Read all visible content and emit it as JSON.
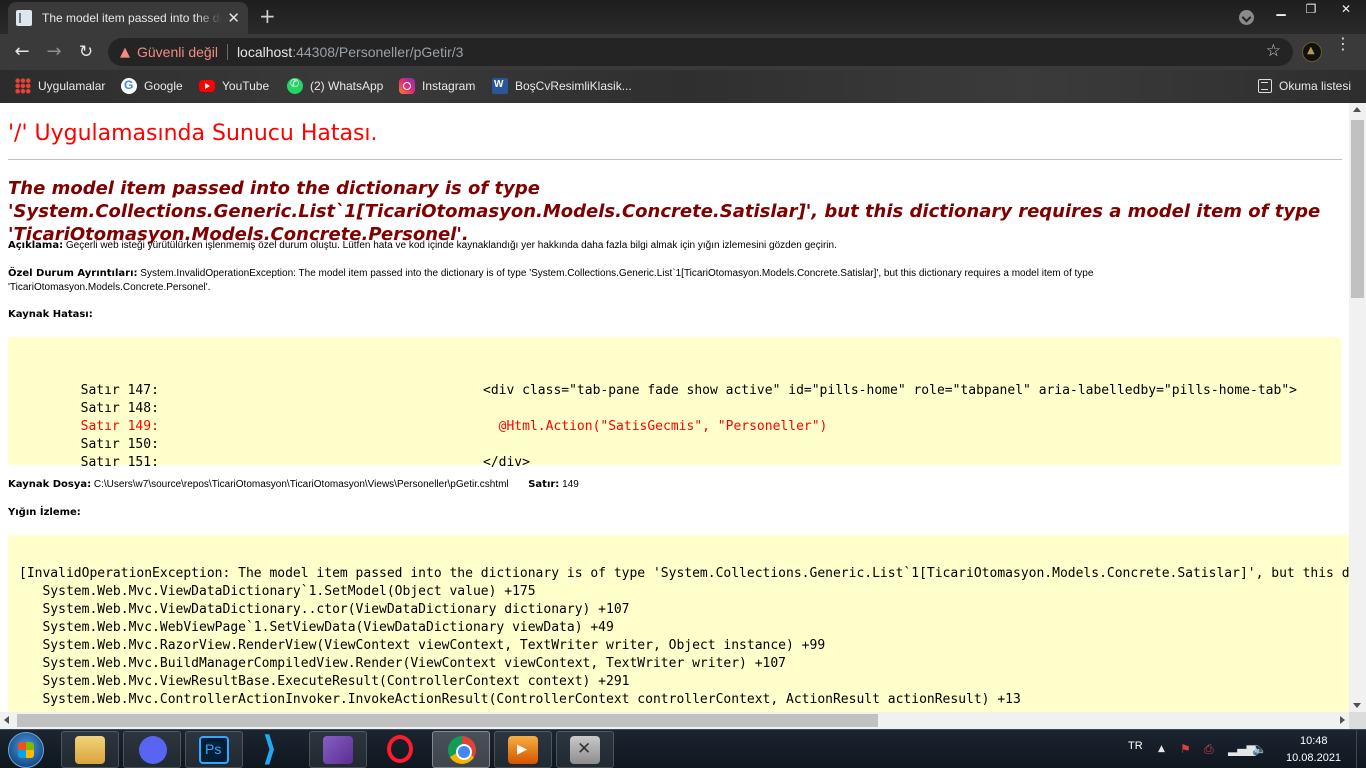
{
  "browser": {
    "tab_title": "The model item passed into the dictionary is of type",
    "tab_close": "✕",
    "new_tab": "+",
    "window_controls": {
      "minimize": "▁",
      "maximize": "❐",
      "close": "✕"
    },
    "nav": {
      "back": "←",
      "forward": "→",
      "reload": "↻"
    },
    "security_label": "Güvenli değil",
    "warning_glyph": "▲",
    "url_host": "localhost",
    "url_path": ":44308/Personeller/pGetir/3",
    "star_glyph": "☆",
    "menu_glyph": "⋮"
  },
  "bookmarks": [
    {
      "label": "Uygulamalar",
      "icon": "apps-grid-icon"
    },
    {
      "label": "Google",
      "icon": "google-icon"
    },
    {
      "label": "YouTube",
      "icon": "youtube-icon"
    },
    {
      "label": "(2) WhatsApp",
      "icon": "whatsapp-icon"
    },
    {
      "label": "Instagram",
      "icon": "instagram-icon"
    },
    {
      "label": "BoşCvResimliKlasik...",
      "icon": "word-icon"
    }
  ],
  "reading_list": "Okuma listesi",
  "page": {
    "title": "'/' Uygulamasında Sunucu Hatası.",
    "message": "The model item passed into the dictionary is of type 'System.Collections.Generic.List`1[TicariOtomasyon.Models.Concrete.Satislar]', but this dictionary requires a model item of type 'TicariOtomasyon.Models.Concrete.Personel'.",
    "description_label": "Açıklama:",
    "description_text": "Geçerli web isteği yürütülürken işlenmemiş özel durum oluştu. Lütfen hata ve kod içinde kaynaklandığı yer hakkında daha fazla bilgi almak için yığın izlemesini gözden geçirin.",
    "details_label": "Özel Durum Ayrıntıları:",
    "details_text": "System.InvalidOperationException: The model item passed into the dictionary is of type 'System.Collections.Generic.List`1[TicariOtomasyon.Models.Concrete.Satislar]', but this dictionary requires a model item of type 'TicariOtomasyon.Models.Concrete.Personel'.",
    "source_error_heading": "Kaynak Hatası:",
    "source_lines": [
      {
        "label": "Satır 147:",
        "code": "<div class=\"tab-pane fade show active\" id=\"pills-home\" role=\"tabpanel\" aria-labelledby=\"pills-home-tab\">"
      },
      {
        "label": "Satır 148:",
        "code": ""
      },
      {
        "label": "Satır 149:",
        "code": "  @Html.Action(\"SatisGecmis\", \"Personeller\")"
      },
      {
        "label": "Satır 150:",
        "code": ""
      },
      {
        "label": "Satır 151:",
        "code": "</div>"
      }
    ],
    "source_file_label": "Kaynak Dosya:",
    "source_file_path": "C:\\Users\\w7\\source\\repos\\TicariOtomasyon\\TicariOtomasyon\\Views\\Personeller\\pGetir.cshtml",
    "line_label": "Satır:",
    "line_value": "149",
    "stack_heading": "Yığın İzleme:",
    "stack_lines": [
      "[InvalidOperationException: The model item passed into the dictionary is of type 'System.Collections.Generic.List`1[TicariOtomasyon.Models.Concrete.Satislar]', but this dictionary requires a model item of type 'TicariOtomasyon.Models.Concrete.Personel'.]",
      "   System.Web.Mvc.ViewDataDictionary`1.SetModel(Object value) +175",
      "   System.Web.Mvc.ViewDataDictionary..ctor(ViewDataDictionary dictionary) +107",
      "   System.Web.Mvc.WebViewPage`1.SetViewData(ViewDataDictionary viewData) +49",
      "   System.Web.Mvc.RazorView.RenderView(ViewContext viewContext, TextWriter writer, Object instance) +99",
      "   System.Web.Mvc.BuildManagerCompiledView.Render(ViewContext viewContext, TextWriter writer) +107",
      "   System.Web.Mvc.ViewResultBase.ExecuteResult(ControllerContext context) +291",
      "   System.Web.Mvc.ControllerActionInvoker.InvokeActionResult(ControllerContext controllerContext, ActionResult actionResult) +13"
    ]
  },
  "taskbar": {
    "language": "TR",
    "time": "10:48",
    "date": "10.08.2021",
    "tray_glyphs": {
      "up": "▲",
      "flag": "⚑",
      "printer": "⎙",
      "signal": "▂▄▆",
      "volume": "🔈"
    }
  },
  "colors": {
    "title_red": "#ff0000",
    "message_maroon": "#800000",
    "code_bg": "#ffffcc",
    "security_warning": "#f28b82"
  }
}
